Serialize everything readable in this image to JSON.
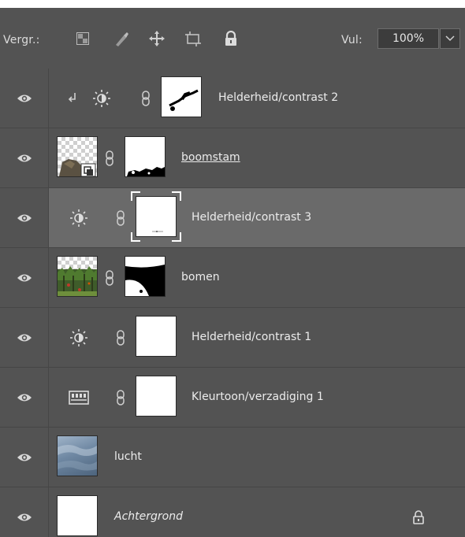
{
  "toolbar": {
    "lock_label": "Vergr.:",
    "lock_icons": [
      "lock-transparent-pixels-icon",
      "lock-image-pixels-icon",
      "lock-position-icon",
      "lock-artboard-icon",
      "lock-all-icon"
    ],
    "fill_label": "Vul:",
    "fill_value": "100%"
  },
  "layers": [
    {
      "name": "Helderheid/contrast 2",
      "type": "adjustment",
      "adjustment_icon": "brightness-contrast-icon",
      "clipped": true,
      "visible": true
    },
    {
      "name": "boomstam",
      "type": "smart-object",
      "visible": true
    },
    {
      "name": "Helderheid/contrast 3",
      "type": "adjustment",
      "adjustment_icon": "brightness-contrast-icon",
      "visible": true,
      "selected": true
    },
    {
      "name": "bomen",
      "type": "pixel",
      "visible": true
    },
    {
      "name": "Helderheid/contrast 1",
      "type": "adjustment",
      "adjustment_icon": "brightness-contrast-icon",
      "visible": true
    },
    {
      "name": "Kleurtoon/verzadiging 1",
      "type": "adjustment",
      "adjustment_icon": "hue-saturation-icon",
      "visible": true
    },
    {
      "name": "lucht",
      "type": "pixel",
      "visible": true
    },
    {
      "name": "Achtergrond",
      "type": "background",
      "visible": true,
      "locked": true
    }
  ],
  "colors": {
    "panel": "#535353",
    "selected_row": "#6a6a6a",
    "text": "#ececec",
    "divider": "#464646"
  }
}
